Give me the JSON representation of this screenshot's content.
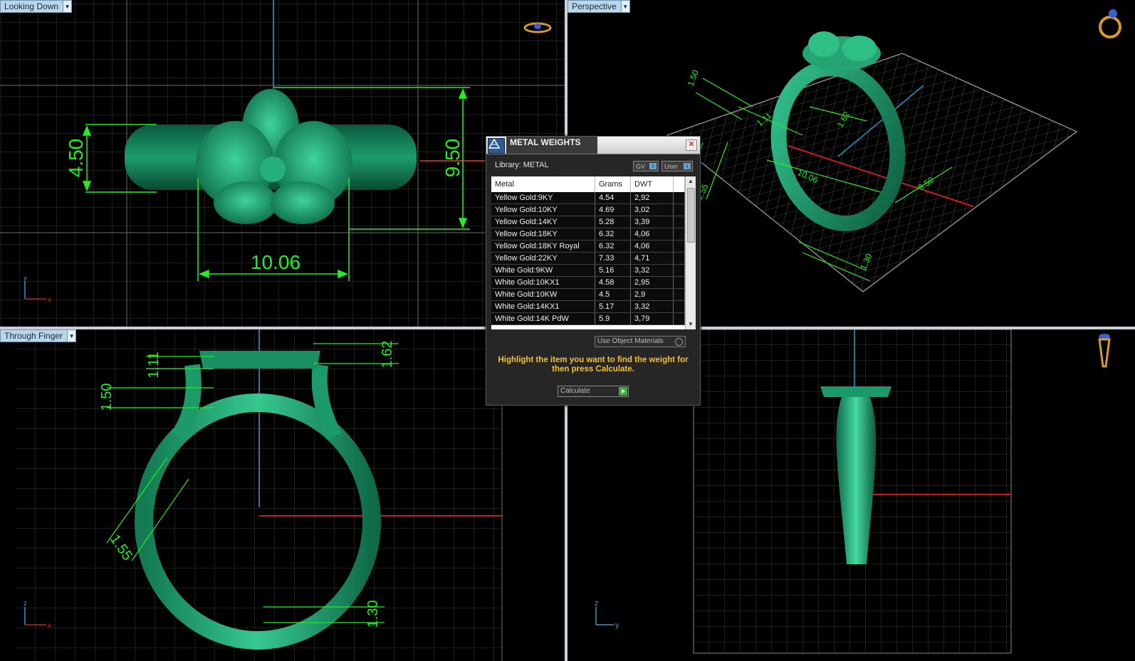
{
  "viewports": {
    "top_left": {
      "label": "Looking Down",
      "axis_h": "x",
      "axis_v": "y"
    },
    "top_right": {
      "label": "Perspective"
    },
    "bottom_left": {
      "label": "Through Finger",
      "axis_h": "x",
      "axis_v": "z"
    },
    "bottom_right": {
      "axis_h": "y",
      "axis_v": "z"
    }
  },
  "dimensions": {
    "top_left": [
      "4.50",
      "9.50",
      "10.06"
    ],
    "top_right": [
      "1.50",
      "1.62",
      "10.06",
      "9.50",
      "1.30",
      "1.55",
      "1.11"
    ],
    "bottom_left": [
      "1.11",
      "1.62",
      "1.50",
      "1.55",
      "1.30"
    ]
  },
  "dialog": {
    "title": "METAL WEIGHTS",
    "close_glyph": "✕",
    "library": "Library: METAL",
    "gv_label": "GV",
    "user_label": "User",
    "columns": [
      "Metal",
      "Grams",
      "DWT"
    ],
    "rows": [
      [
        "Yellow Gold:9KY",
        "4.54",
        "2,92"
      ],
      [
        "Yellow Gold:10KY",
        "4.69",
        "3,02"
      ],
      [
        "Yellow Gold:14KY",
        "5.28",
        "3,39"
      ],
      [
        "Yellow Gold:18KY",
        "6.32",
        "4,06"
      ],
      [
        "Yellow Gold:18KY Royal",
        "6.32",
        "4,06"
      ],
      [
        "Yellow Gold:22KY",
        "7.33",
        "4,71"
      ],
      [
        "White Gold:9KW",
        "5.16",
        "3,32"
      ],
      [
        "White Gold:10KX1",
        "4.58",
        "2,95"
      ],
      [
        "White Gold:10KW",
        "4.5",
        "2,9"
      ],
      [
        "White Gold:14KX1",
        "5.17",
        "3,32"
      ],
      [
        "White Gold:14K PdW",
        "5.9",
        "3,79"
      ]
    ],
    "use_object_materials": "Use Object Materials",
    "hint": "Highlight the item you want to find the weight for then press Calculate.",
    "calculate_label": "Calculate"
  },
  "colors": {
    "model": "#1a9a6a",
    "dimension": "#22ee22",
    "grid": "#4a4a4a",
    "axis_x": "#c41e1e",
    "axis_y": "#1f7d9b",
    "hint": "#f2c22e"
  }
}
